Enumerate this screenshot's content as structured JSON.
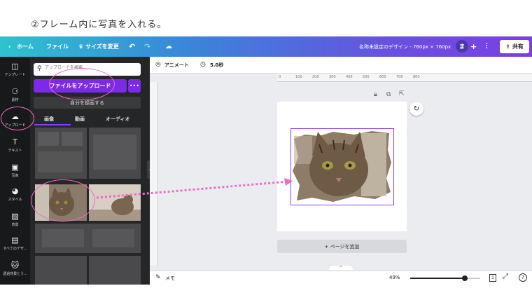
{
  "caption": "②フレーム内に写真を入れる。",
  "topbar": {
    "home": "ホーム",
    "file": "ファイル",
    "resize": "サイズを変更",
    "title": "名称未設定のデザイン - 760px × 760px",
    "avatar": "ま",
    "share": "共有"
  },
  "rail": {
    "items": [
      {
        "label": "テンプレート",
        "icon": "template-icon"
      },
      {
        "label": "素材",
        "icon": "elements-icon"
      },
      {
        "label": "アップロード",
        "icon": "upload-icon"
      },
      {
        "label": "テキスト",
        "icon": "text-icon"
      },
      {
        "label": "写真",
        "icon": "photo-icon"
      },
      {
        "label": "スタイル",
        "icon": "style-icon"
      },
      {
        "label": "背景",
        "icon": "background-icon"
      },
      {
        "label": "すべてのデザ...",
        "icon": "designs-icon"
      },
      {
        "label": "透過背景とう...",
        "icon": "app-icon"
      }
    ]
  },
  "panel": {
    "search_placeholder": "アップロードを検索",
    "upload_button": "ファイルをアップロード",
    "more": "•••",
    "record_button": "自分を録画する",
    "tabs": [
      "画像",
      "動画",
      "オーディオ"
    ]
  },
  "editor": {
    "animate": "アニメート",
    "duration": "5.0秒",
    "ruler_ticks": [
      "0",
      "100",
      "200",
      "300",
      "400",
      "500",
      "600",
      "700",
      "800"
    ],
    "add_page": "+ ページを追加"
  },
  "footer": {
    "notes": "メモ",
    "zoom": "49%",
    "page_count": "1",
    "zoom_level": 0.49
  },
  "colors": {
    "accent": "#7d2ae8",
    "highlight": "#f06bc4"
  }
}
